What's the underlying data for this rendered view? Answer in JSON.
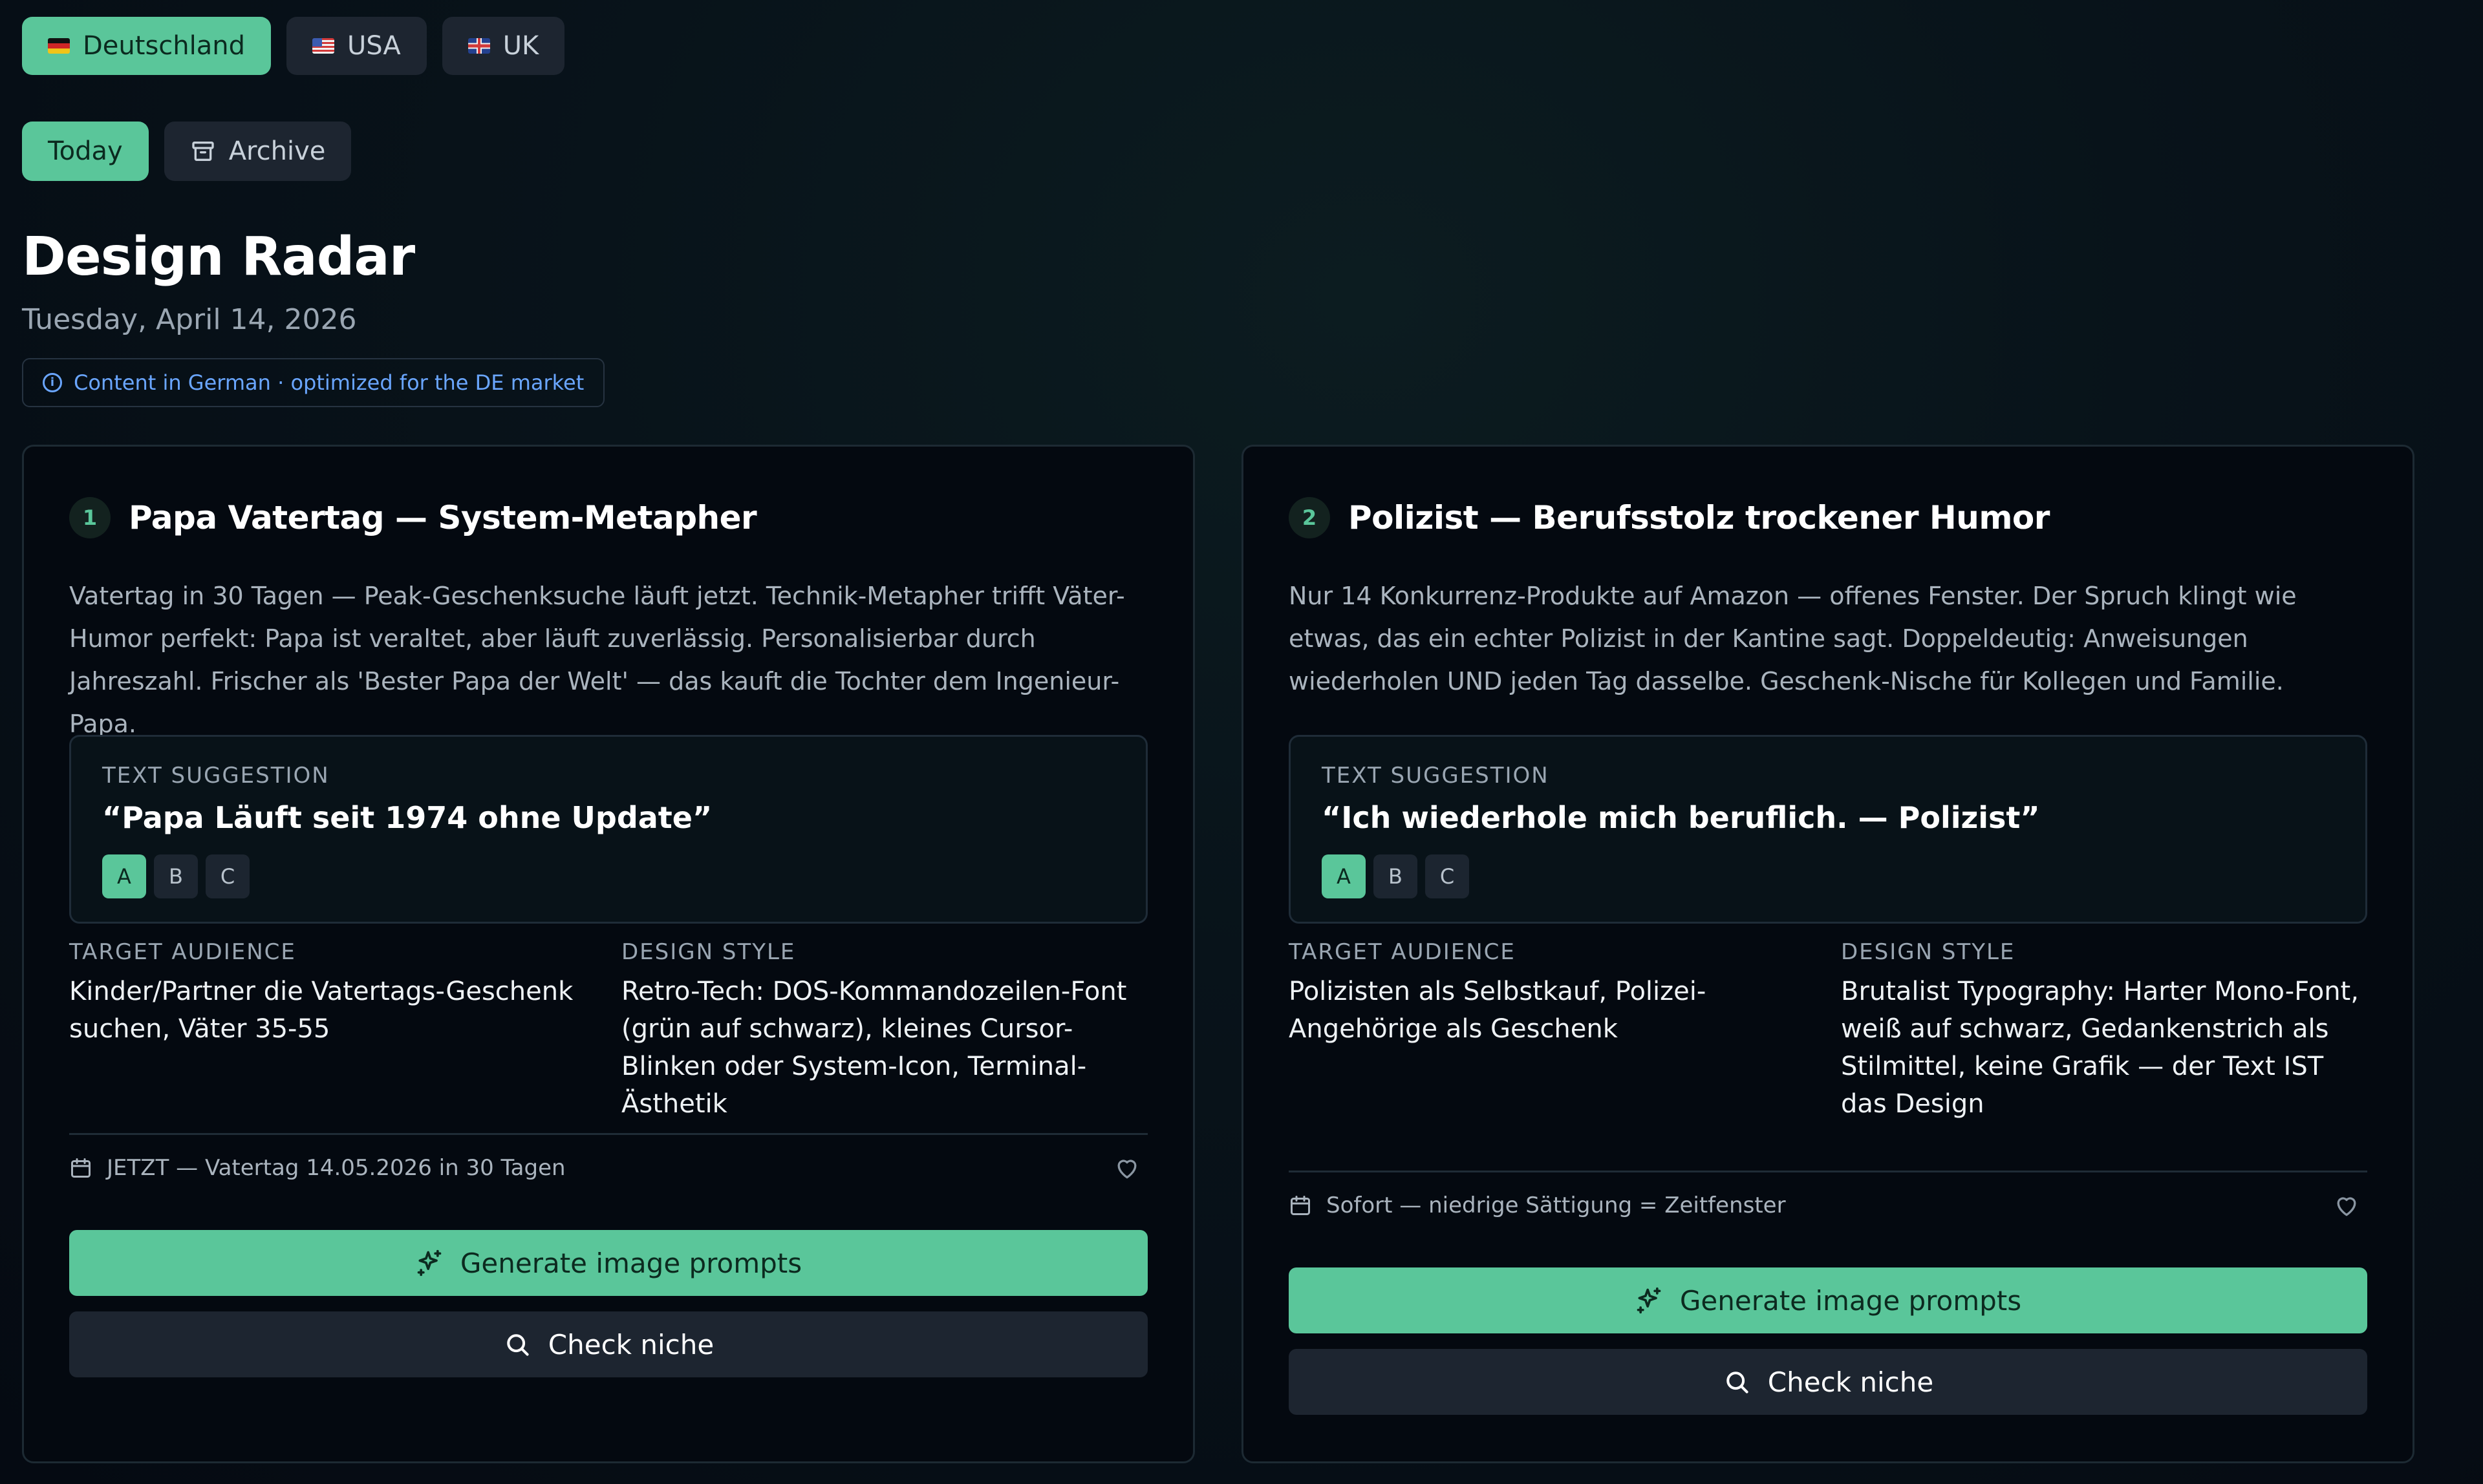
{
  "markets": [
    {
      "label": "Deutschland",
      "flag": "de-flag-icon",
      "active": true
    },
    {
      "label": "USA",
      "flag": "us-flag-icon",
      "active": false
    },
    {
      "label": "UK",
      "flag": "uk-flag-icon",
      "active": false
    }
  ],
  "views": {
    "today_label": "Today",
    "archive_label": "Archive"
  },
  "header": {
    "title": "Design Radar",
    "date": "Tuesday, April 14, 2026",
    "info_badge": "Content in German · optimized for the DE market"
  },
  "labels": {
    "text_suggestion": "TEXT SUGGESTION",
    "target_audience": "TARGET AUDIENCE",
    "design_style": "DESIGN STYLE",
    "generate_button": "Generate image prompts",
    "check_button": "Check niche"
  },
  "cards": [
    {
      "number": "1",
      "title": "Papa Vatertag — System-Metapher",
      "description": "Vatertag in 30 Tagen — Peak-Geschenksuche läuft jetzt. Technik-Metapher trifft Väter-Humor perfekt: Papa ist veraltet, aber läuft zuverlässig. Personalisierbar durch Jahreszahl. Frischer als 'Bester Papa der Welt' — das kauft die Tochter dem Ingenieur-Papa.",
      "suggestion": "“Papa Läuft seit 1974 ohne Update”",
      "variants": [
        "A",
        "B",
        "C"
      ],
      "active_variant": "A",
      "audience": "Kinder/Partner die Vatertags-Geschenk suchen, Väter 35-55",
      "style": "Retro-Tech: DOS-Kommandozeilen-Font (grün auf schwarz), kleines Cursor-Blinken oder System-Icon, Terminal-Ästhetik",
      "timing": "JETZT — Vatertag 14.05.2026 in 30 Tagen"
    },
    {
      "number": "2",
      "title": "Polizist — Berufsstolz trockener Humor",
      "description": "Nur 14 Konkurrenz-Produkte auf Amazon — offenes Fenster. Der Spruch klingt wie etwas, das ein echter Polizist in der Kantine sagt. Doppeldeutig: Anweisungen wiederholen UND jeden Tag dasselbe. Geschenk-Nische für Kollegen und Familie.",
      "suggestion": "“Ich wiederhole mich beruflich. — Polizist”",
      "variants": [
        "A",
        "B",
        "C"
      ],
      "active_variant": "A",
      "audience": "Polizisten als Selbstkauf, Polizei-Angehörige als Geschenk",
      "style": "Brutalist Typography: Harter Mono-Font, weiß auf schwarz, Gedankenstrich als Stilmittel, keine Grafik — der Text IST das Design",
      "timing": "Sofort — niedrige Sättigung = Zeitfenster"
    }
  ],
  "colors": {
    "accent": "#5ac69a",
    "info": "#6aa6ff",
    "background": "#050a12",
    "card": "#040910"
  }
}
